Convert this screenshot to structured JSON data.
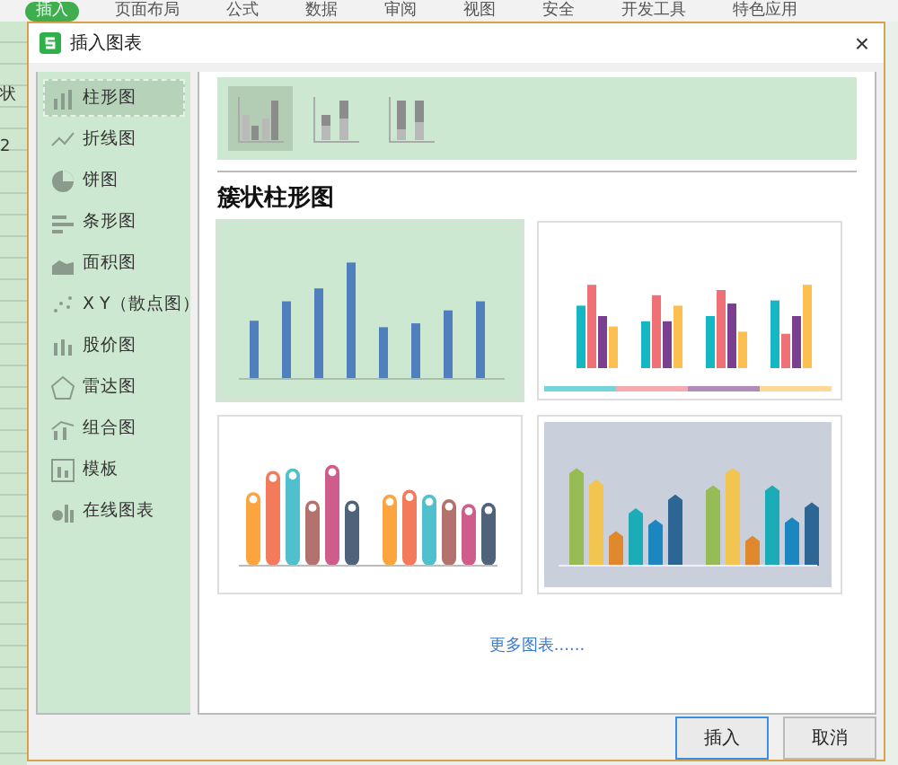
{
  "ribbon": {
    "tabs": [
      {
        "label": "插入",
        "selected": true
      },
      {
        "label": "页面布局",
        "selected": false
      },
      {
        "label": "公式",
        "selected": false
      },
      {
        "label": "数据",
        "selected": false
      },
      {
        "label": "审阅",
        "selected": false
      },
      {
        "label": "视图",
        "selected": false
      },
      {
        "label": "安全",
        "selected": false
      },
      {
        "label": "开发工具",
        "selected": false
      },
      {
        "label": "特色应用",
        "selected": false
      }
    ]
  },
  "sheet": {
    "toolbar_fragment": "状",
    "cell_fragment": "2"
  },
  "dialog": {
    "title": "插入图表",
    "close": "×",
    "categories": [
      {
        "label": "柱形图",
        "kind": "column",
        "selected": true
      },
      {
        "label": "折线图",
        "kind": "line",
        "selected": false
      },
      {
        "label": "饼图",
        "kind": "pie",
        "selected": false
      },
      {
        "label": "条形图",
        "kind": "bar",
        "selected": false
      },
      {
        "label": "面积图",
        "kind": "area",
        "selected": false
      },
      {
        "label": "X Y（散点图）",
        "kind": "scatter",
        "selected": false
      },
      {
        "label": "股价图",
        "kind": "stock",
        "selected": false
      },
      {
        "label": "雷达图",
        "kind": "radar",
        "selected": false
      },
      {
        "label": "组合图",
        "kind": "combo",
        "selected": false
      },
      {
        "label": "模板",
        "kind": "template",
        "selected": false
      },
      {
        "label": "在线图表",
        "kind": "online",
        "selected": false
      }
    ],
    "subtypes": [
      {
        "kind": "clustered",
        "selected": true
      },
      {
        "kind": "stacked",
        "selected": false
      },
      {
        "kind": "percent",
        "selected": false
      }
    ],
    "heading": "簇状柱形图",
    "templates": [
      {
        "kind": "simple",
        "selected": true
      },
      {
        "kind": "fashion",
        "selected": false
      },
      {
        "kind": "rounded",
        "selected": false
      },
      {
        "kind": "arrow",
        "selected": false
      }
    ],
    "more_link": "更多图表......",
    "buttons": [
      {
        "label": "插入",
        "default": true
      },
      {
        "label": "取消",
        "default": false
      }
    ]
  }
}
